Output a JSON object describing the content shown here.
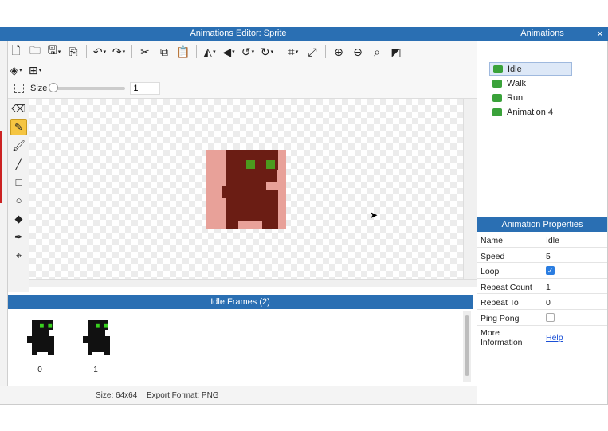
{
  "window": {
    "title": "Animations Editor: Sprite",
    "close_glyph": "×"
  },
  "toolbar": {
    "row1": [
      {
        "icon": "new-file-icon",
        "glyph": "🗋"
      },
      {
        "icon": "open-folder-icon",
        "glyph": "🗀"
      },
      {
        "icon": "save-icon",
        "glyph": "🖫",
        "caret": "▾"
      },
      {
        "icon": "export-icon",
        "glyph": "⎘"
      },
      {
        "icon": "undo-icon",
        "glyph": "↶",
        "caret": "▾"
      },
      {
        "icon": "redo-icon",
        "glyph": "↷",
        "caret": "▾"
      },
      {
        "icon": "cut-icon",
        "glyph": "✂"
      },
      {
        "icon": "copy-icon",
        "glyph": "⧉"
      },
      {
        "icon": "paste-icon",
        "glyph": "📋"
      },
      {
        "icon": "flip-horizontal-icon",
        "glyph": "◭",
        "caret": "▾"
      },
      {
        "icon": "flip-vertical-icon",
        "glyph": "◀",
        "caret": "▾"
      },
      {
        "icon": "rotate-left-icon",
        "glyph": "↺",
        "caret": "▾"
      },
      {
        "icon": "rotate-right-icon",
        "glyph": "↻",
        "caret": "▾"
      },
      {
        "icon": "crop-icon",
        "glyph": "⌗",
        "caret": "▾"
      },
      {
        "icon": "resize-icon",
        "glyph": "⤢"
      },
      {
        "icon": "zoom-in-icon",
        "glyph": "⊕"
      },
      {
        "icon": "zoom-out-icon",
        "glyph": "⊖"
      },
      {
        "icon": "zoom-fit-icon",
        "glyph": "⌕"
      },
      {
        "icon": "contrast-icon",
        "glyph": "◩"
      }
    ],
    "row2": [
      {
        "icon": "layers-icon",
        "glyph": "◈",
        "caret": "▾"
      },
      {
        "icon": "grid-icon",
        "glyph": "⊞",
        "caret": "▾"
      }
    ]
  },
  "size_bar": {
    "label": "Size",
    "value": "1"
  },
  "tools": [
    {
      "name": "eraser-tool",
      "glyph": "⌫"
    },
    {
      "name": "pencil-tool",
      "glyph": "✎",
      "active": true
    },
    {
      "name": "brush-tool",
      "glyph": "🖌"
    },
    {
      "name": "line-tool",
      "glyph": "╱"
    },
    {
      "name": "rectangle-tool",
      "glyph": "□"
    },
    {
      "name": "ellipse-tool",
      "glyph": "○"
    },
    {
      "name": "fill-tool",
      "glyph": "◆"
    },
    {
      "name": "eyedropper-tool",
      "glyph": "✒"
    },
    {
      "name": "move-tool",
      "glyph": "⌖"
    }
  ],
  "frames": {
    "header": "Idle Frames (2)",
    "items": [
      {
        "number": "0"
      },
      {
        "number": "1"
      }
    ]
  },
  "status": {
    "size": "Size: 64x64",
    "export_format": "Export Format: PNG"
  },
  "animations": {
    "header": "Animations",
    "items": [
      {
        "label": "Idle",
        "selected": true
      },
      {
        "label": "Walk"
      },
      {
        "label": "Run"
      },
      {
        "label": "Animation 4"
      }
    ],
    "icon_color": "#3aa23a"
  },
  "properties": {
    "header": "Animation Properties",
    "rows": [
      {
        "key": "Name",
        "value": "Idle"
      },
      {
        "key": "Speed",
        "value": "5"
      },
      {
        "key": "Loop",
        "checked": true
      },
      {
        "key": "Repeat Count",
        "value": "1"
      },
      {
        "key": "Repeat To",
        "value": "0"
      },
      {
        "key": "Ping Pong",
        "checked": false
      },
      {
        "key": "More Information",
        "link": "Help"
      }
    ]
  },
  "colors": {
    "accent": "#2a6fb3",
    "sprite_background": "#e8a199",
    "sprite_body": "#6b1d14",
    "sprite_eye": "#4c9a1e",
    "frame_body": "#111111",
    "frame_eye": "#39d11f"
  }
}
